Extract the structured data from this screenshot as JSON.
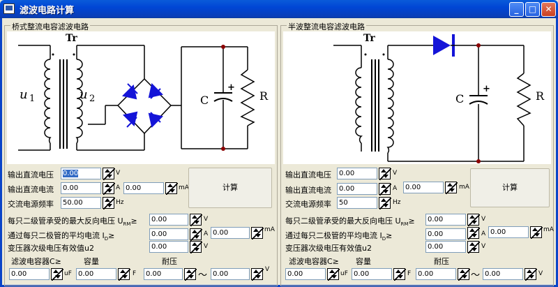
{
  "window": {
    "title": "滤波电路计算",
    "minimize": "_",
    "maximize": "□",
    "close": "✕"
  },
  "left": {
    "group_title": "桥式整流电容滤波电路",
    "diagram": {
      "tr": "Tr",
      "u1": "u",
      "u1_sub": "1",
      "u2": "u",
      "u2_sub": "2",
      "c": "C",
      "plus": "+",
      "r": "R"
    },
    "out_voltage_label": "输出直流电压",
    "out_voltage": "0.00",
    "out_voltage_unit": "V",
    "out_current_label": "输出直流电流",
    "out_current": "0.00",
    "out_current_unit": "A",
    "out_current_ma": "0.00",
    "out_current_ma_unit": "mA",
    "freq_label": "交流电源频率",
    "freq": "50.00",
    "freq_unit": "Hz",
    "calc_button": "计算",
    "vrm_label": "每只二级管承受的最大反向电压 U",
    "vrm_sub": "RM",
    "vrm_suffix": "≥",
    "vrm": "0.00",
    "vrm_unit": "V",
    "id_label": "通过每只二极管的平均电流  I",
    "id_sub": "D",
    "id_suffix": "≥",
    "id": "0.00",
    "id_unit": "A",
    "id_ma": "0.00",
    "id_ma_unit": "mA",
    "u2_label": "变压器次级电压有效值u2",
    "u2": "0.00",
    "u2_unit": "V",
    "cap_label": "滤波电容器C≥",
    "cap_val_label": "容量",
    "cap_volt_label": "耐压",
    "cap_uf": "0.00",
    "cap_uf_unit": "uF",
    "cap_f": "0.00",
    "cap_f_unit": "F",
    "volt_min": "0.00",
    "tilde": "～",
    "volt_max": "0.00",
    "volt_unit": "V"
  },
  "right": {
    "group_title": "半波整流电容滤波电路",
    "diagram": {
      "tr": "Tr",
      "c": "C",
      "plus": "+",
      "r": "R"
    },
    "out_voltage_label": "输出直流电压",
    "out_voltage": "0.00",
    "out_voltage_unit": "V",
    "out_current_label": "输出直流电流",
    "out_current": "0.00",
    "out_current_unit": "A",
    "out_current_ma": "0.00",
    "out_current_ma_unit": "mA",
    "freq_label": "交流电源频率",
    "freq": "50",
    "freq_unit": "Hz",
    "calc_button": "计算",
    "vrm_label": "每只二级管承受的最大反向电压 U",
    "vrm_sub": "RM",
    "vrm_suffix": "≥",
    "vrm": "0.00",
    "vrm_unit": "V",
    "id_label": "通过每只二极管的平均电流  I",
    "id_sub": "D",
    "id_suffix": "≥",
    "id": "0.00",
    "id_unit": "A",
    "id_ma": "0.00",
    "id_ma_unit": "mA",
    "u2_label": "变压器次级电压有效值u2",
    "u2": "0.00",
    "u2_unit": "V",
    "cap_label": "滤波电容器C≥",
    "cap_val_label": "容量",
    "cap_volt_label": "耐压",
    "cap_uf": "0.00",
    "cap_uf_unit": "uF",
    "cap_f": "0.00",
    "cap_f_unit": "F",
    "volt_min": "0.00",
    "tilde": "～",
    "volt_max": "0.00",
    "volt_unit": "V"
  },
  "colors": {
    "title_bar": "#0a5bd9",
    "diode": "#1414d8",
    "wire": "#000000",
    "node": "#8b0000",
    "window_bg": "#ece9d8"
  }
}
